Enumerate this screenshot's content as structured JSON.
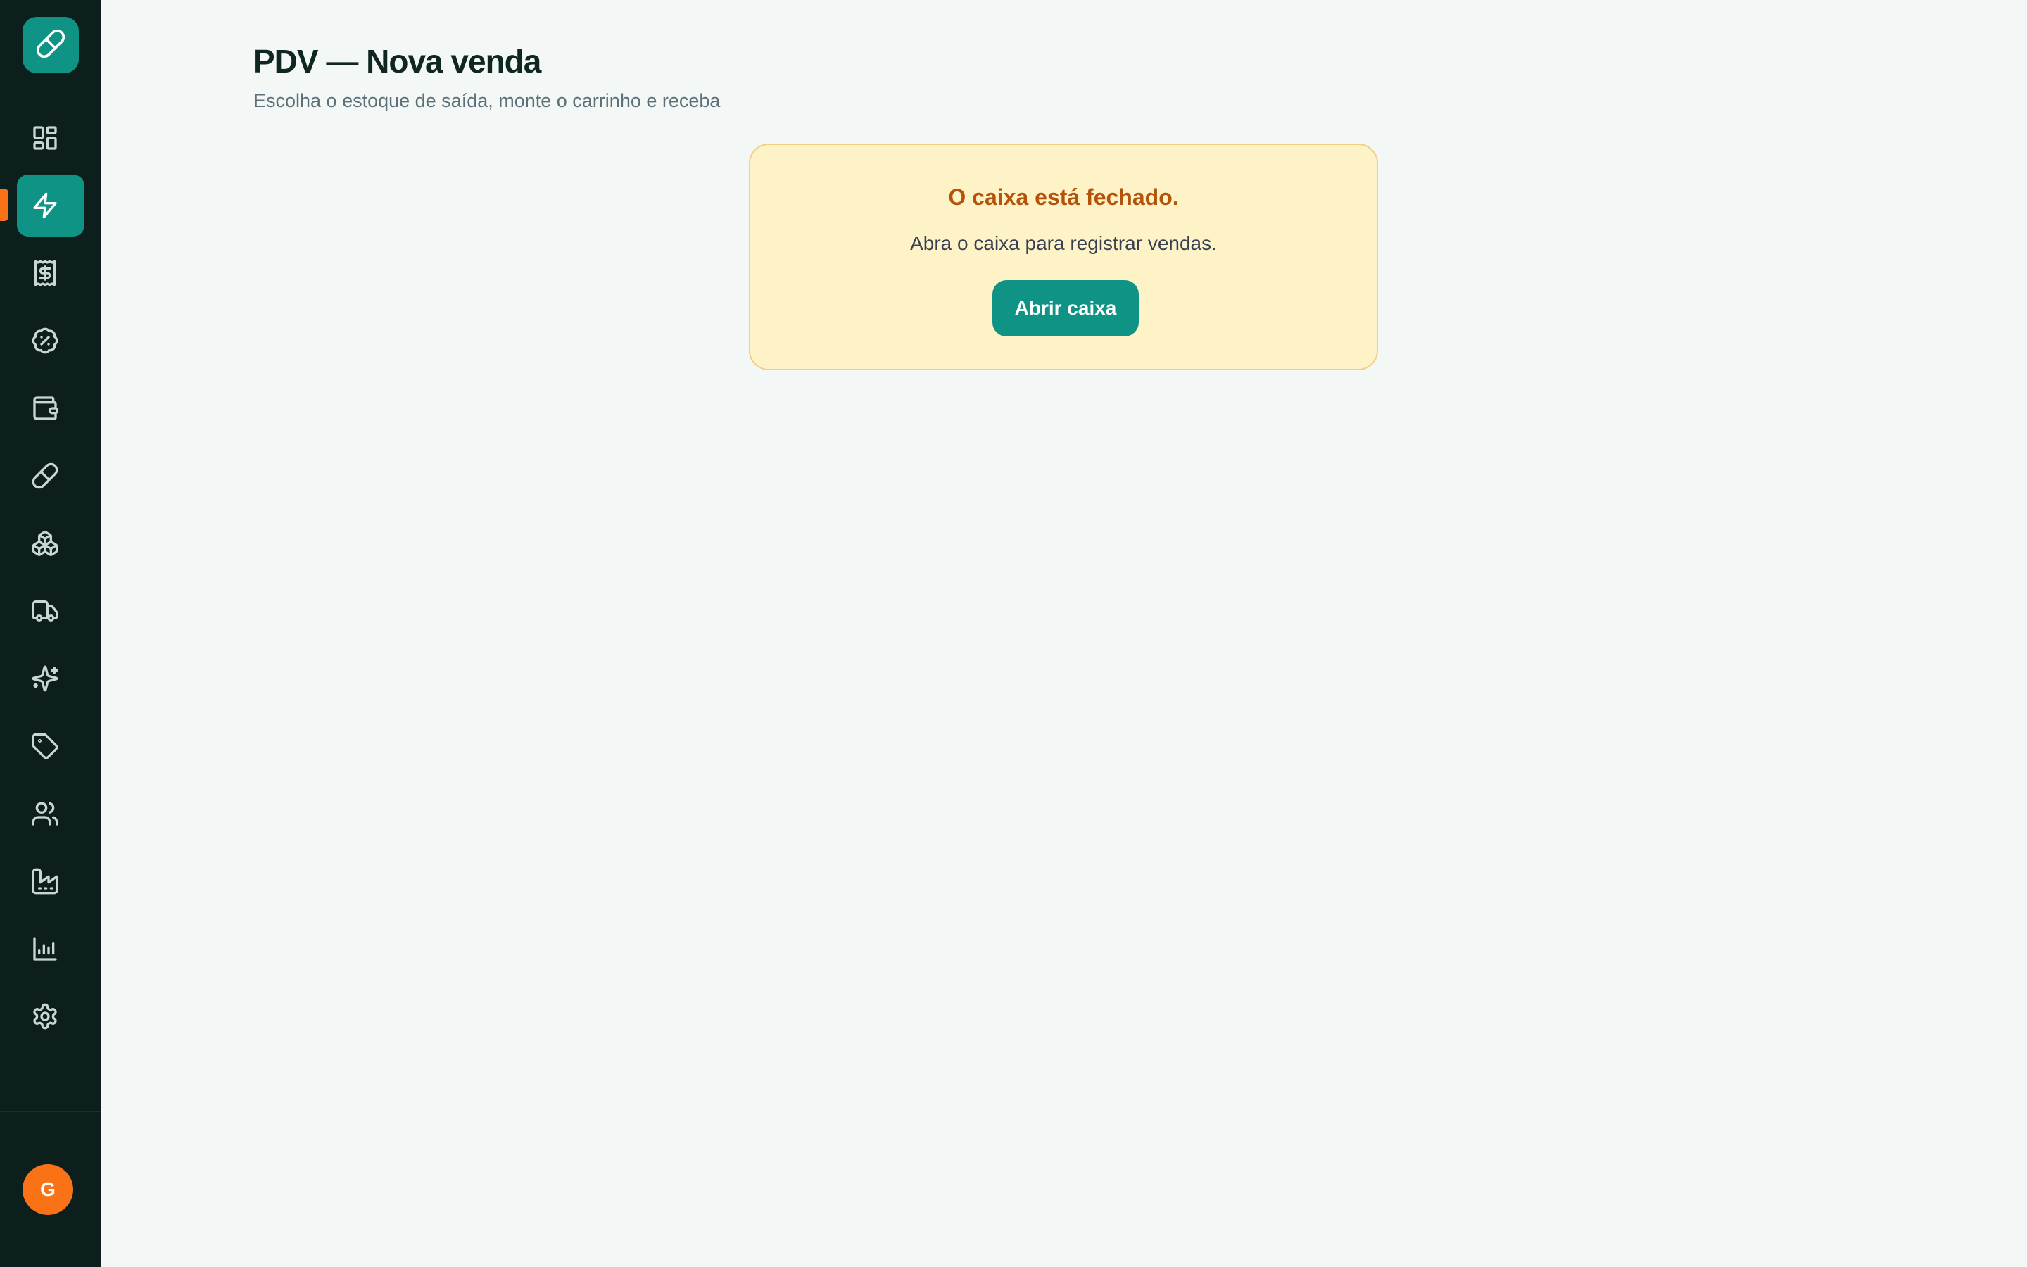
{
  "header": {
    "title": "PDV — Nova venda",
    "subtitle": "Escolha o estoque de saída, monte o carrinho e receba"
  },
  "notice": {
    "title": "O caixa está fechado.",
    "message": "Abra o caixa para registrar vendas.",
    "button_label": "Abrir caixa"
  },
  "sidebar": {
    "logo_icon": "pill-icon",
    "active_item": "pdv",
    "items": [
      {
        "id": "dashboard",
        "icon": "dashboard-icon"
      },
      {
        "id": "pdv",
        "icon": "lightning-icon"
      },
      {
        "id": "sales",
        "icon": "receipt-dollar-icon"
      },
      {
        "id": "discounts",
        "icon": "percent-badge-icon"
      },
      {
        "id": "wallet",
        "icon": "wallet-icon"
      },
      {
        "id": "products",
        "icon": "pill-icon"
      },
      {
        "id": "stock",
        "icon": "boxes-icon"
      },
      {
        "id": "delivery",
        "icon": "truck-icon"
      },
      {
        "id": "promotions",
        "icon": "sparkles-icon"
      },
      {
        "id": "tags",
        "icon": "tag-icon"
      },
      {
        "id": "customers",
        "icon": "users-icon"
      },
      {
        "id": "suppliers",
        "icon": "factory-icon"
      },
      {
        "id": "reports",
        "icon": "bar-chart-icon"
      },
      {
        "id": "settings",
        "icon": "gear-icon"
      }
    ],
    "user_initial": "G"
  },
  "colors": {
    "sidebar_bg": "#0c1f1c",
    "accent": "#0f9384",
    "active_marker": "#f97316",
    "avatar": "#f97316",
    "notice_bg": "#fef3c7",
    "notice_border": "#f1cf83",
    "notice_title": "#b45309",
    "page_bg": "#f3f7f5"
  }
}
